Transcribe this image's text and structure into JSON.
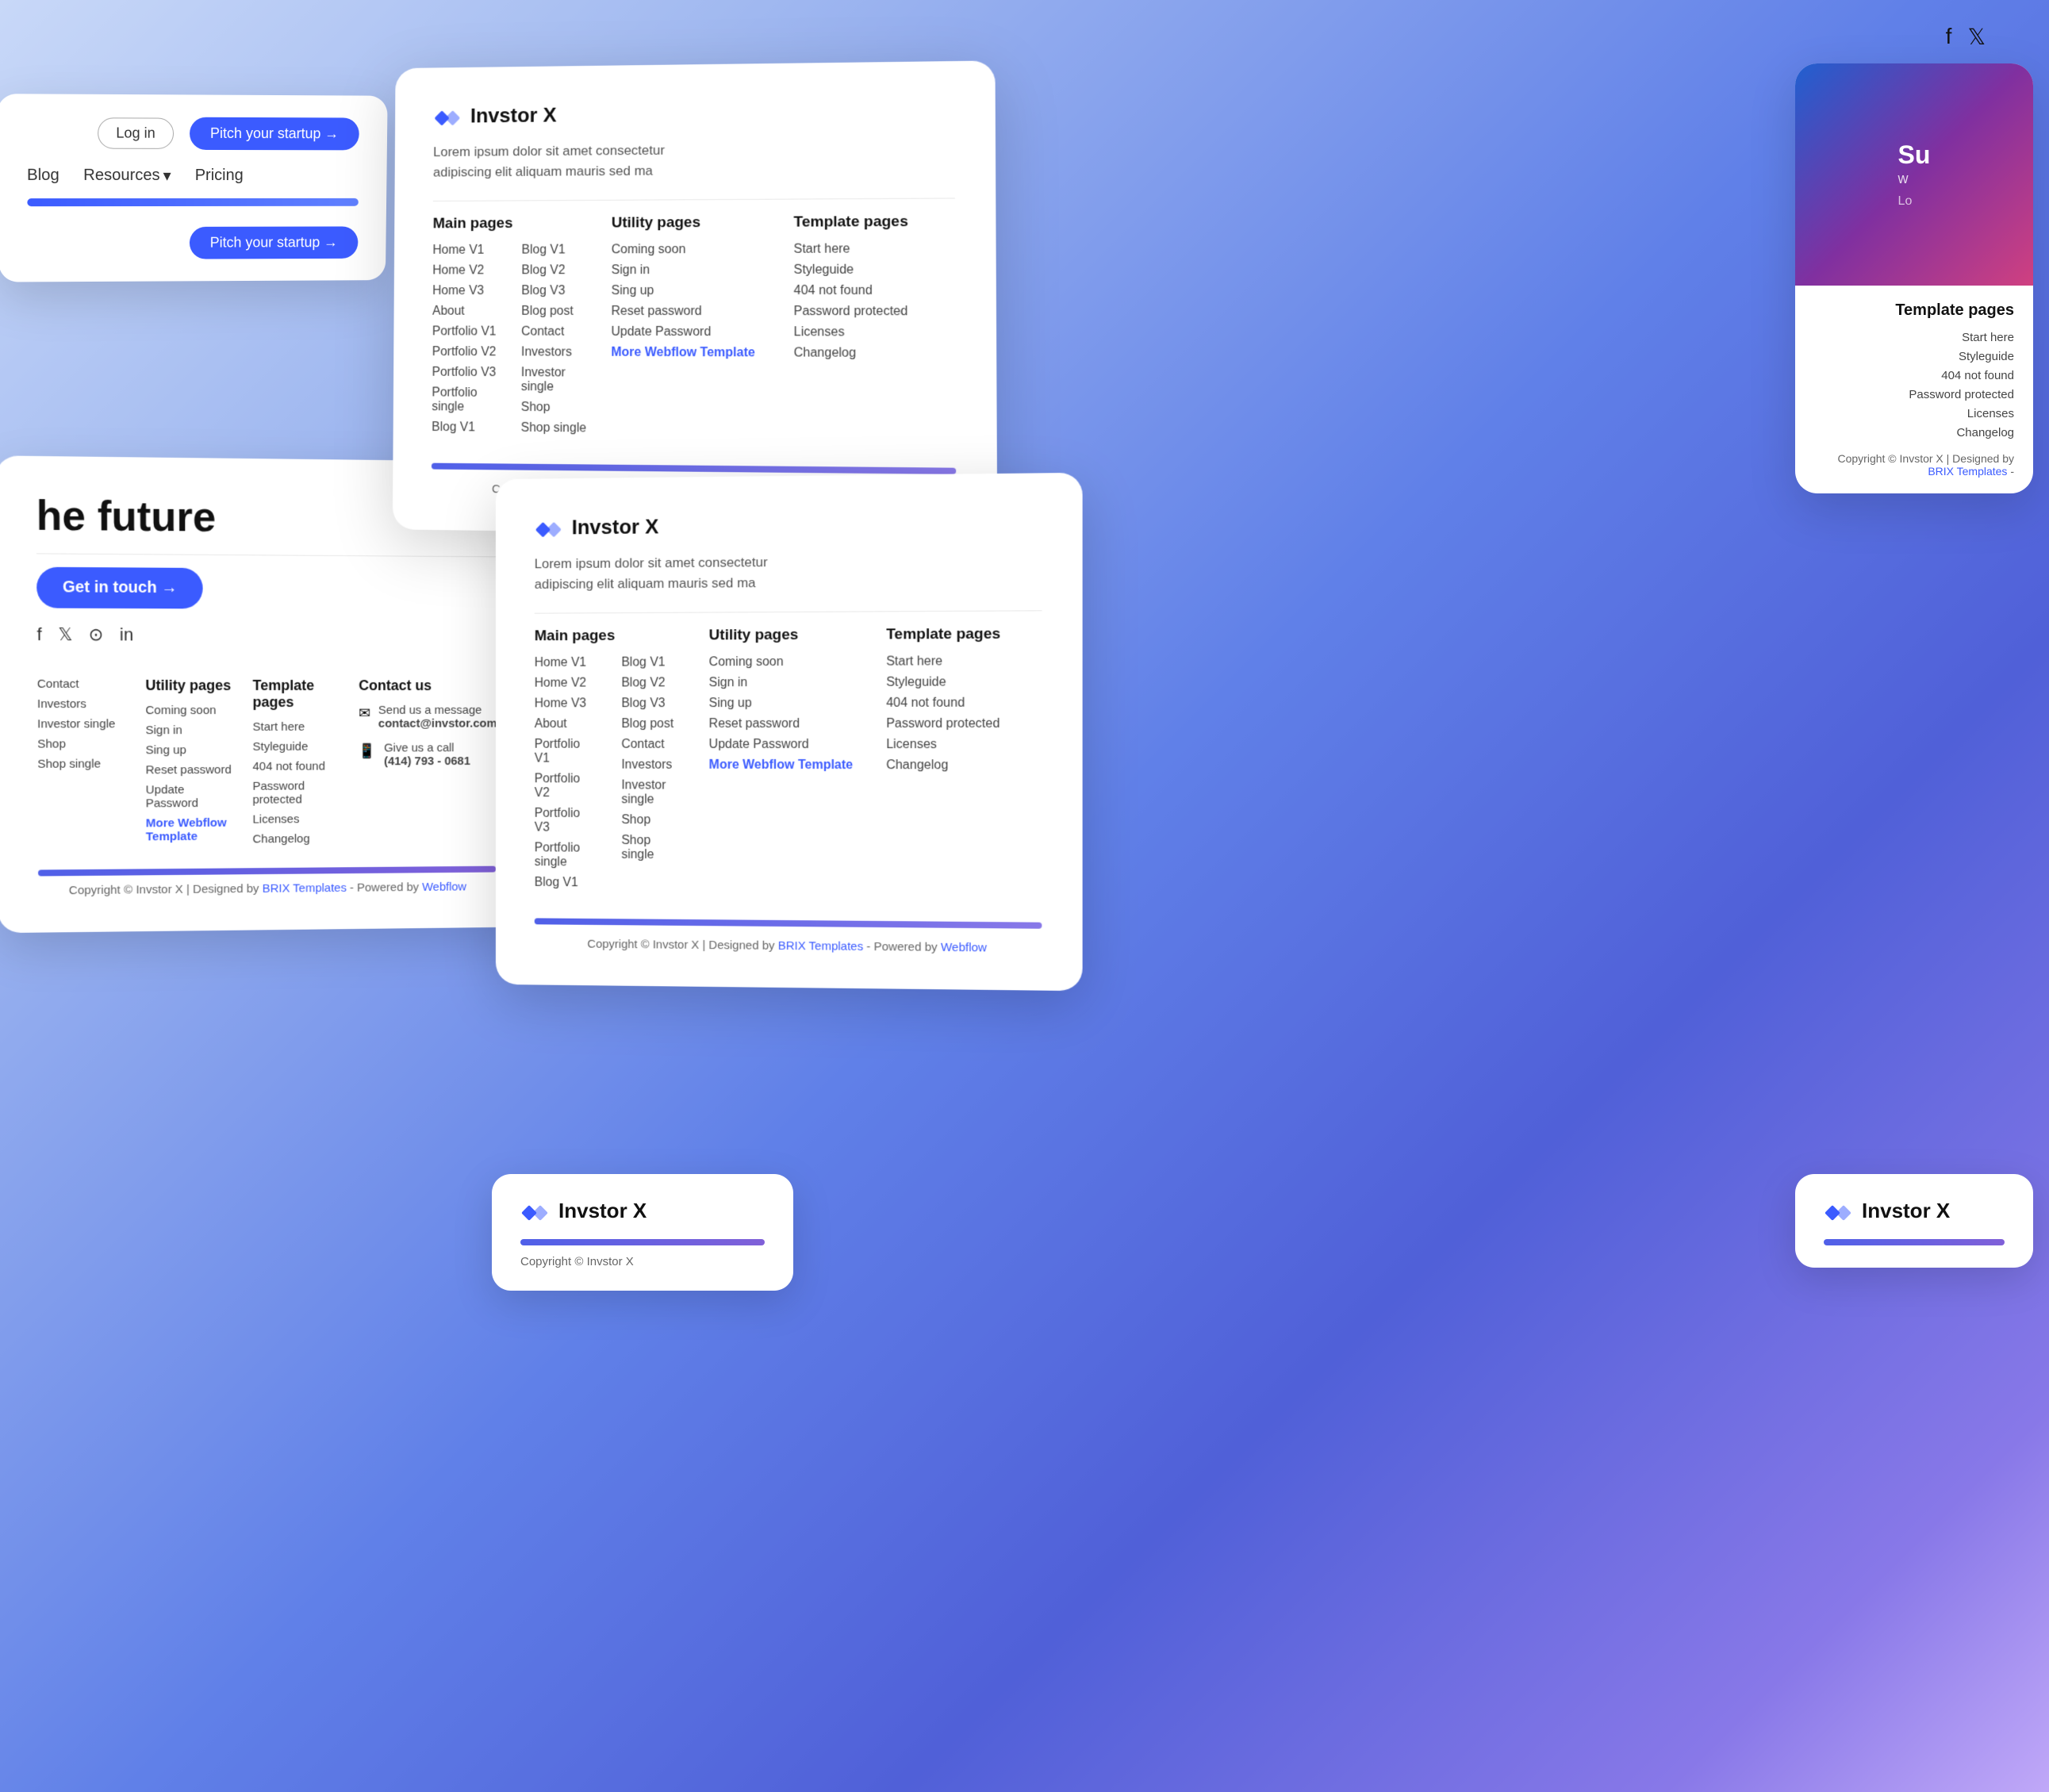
{
  "social": {
    "facebook": "f",
    "twitter": "𝕏"
  },
  "brand": {
    "name": "Invstor X",
    "description": "Lorem ipsum dolor sit amet consectetur adipiscing elit aliquam mauris sed ma"
  },
  "nav": {
    "blog": "Blog",
    "resources": "Resources",
    "pricing": "Pricing",
    "login": "Log in",
    "pitch_btn": "Pitch your startup →",
    "pitch_btn2": "Pitch your startup →"
  },
  "get_in_touch_btn": "Get in touch →",
  "headline": "he future",
  "main_pages": {
    "title": "Main pages",
    "col1": [
      "Home V1",
      "Home V2",
      "Home V3",
      "About",
      "Portfolio V1",
      "Portfolio V2",
      "Portfolio V3",
      "Portfolio single",
      "Blog V1"
    ],
    "col2": [
      "Blog V1",
      "Blog V2",
      "Blog V3",
      "Blog post",
      "Contact",
      "Investors",
      "Investor single",
      "Shop",
      "Shop single"
    ]
  },
  "utility_pages": {
    "title": "Utility pages",
    "items": [
      "Coming soon",
      "Sign in",
      "Sing up",
      "Reset password",
      "Update Password",
      "More Webflow Template"
    ]
  },
  "template_pages": {
    "title": "Template pages",
    "items": [
      "Start here",
      "Styleguide",
      "404 not found",
      "Password protected",
      "Licenses",
      "Changelog"
    ]
  },
  "contact": {
    "title": "Contact us",
    "email_label": "Send us a message",
    "email": "contact@invstor.com",
    "phone_label": "Give us a call",
    "phone": "(414) 793 - 0681"
  },
  "copyright": "Copyright © Invstor X | Designed by ",
  "copyright_link": "BRIX Templates",
  "copyright_suffix": " - Powered by ",
  "copyright_link2": "Webflow",
  "copyright_suffix2": "",
  "card_right_overlay": "Su w",
  "card_right_sub": "Lo",
  "footer_nav": {
    "contact": "Contact",
    "investors": "Investors",
    "investor_single": "Investor single",
    "shop": "Shop",
    "shop_single": "Shop single"
  }
}
